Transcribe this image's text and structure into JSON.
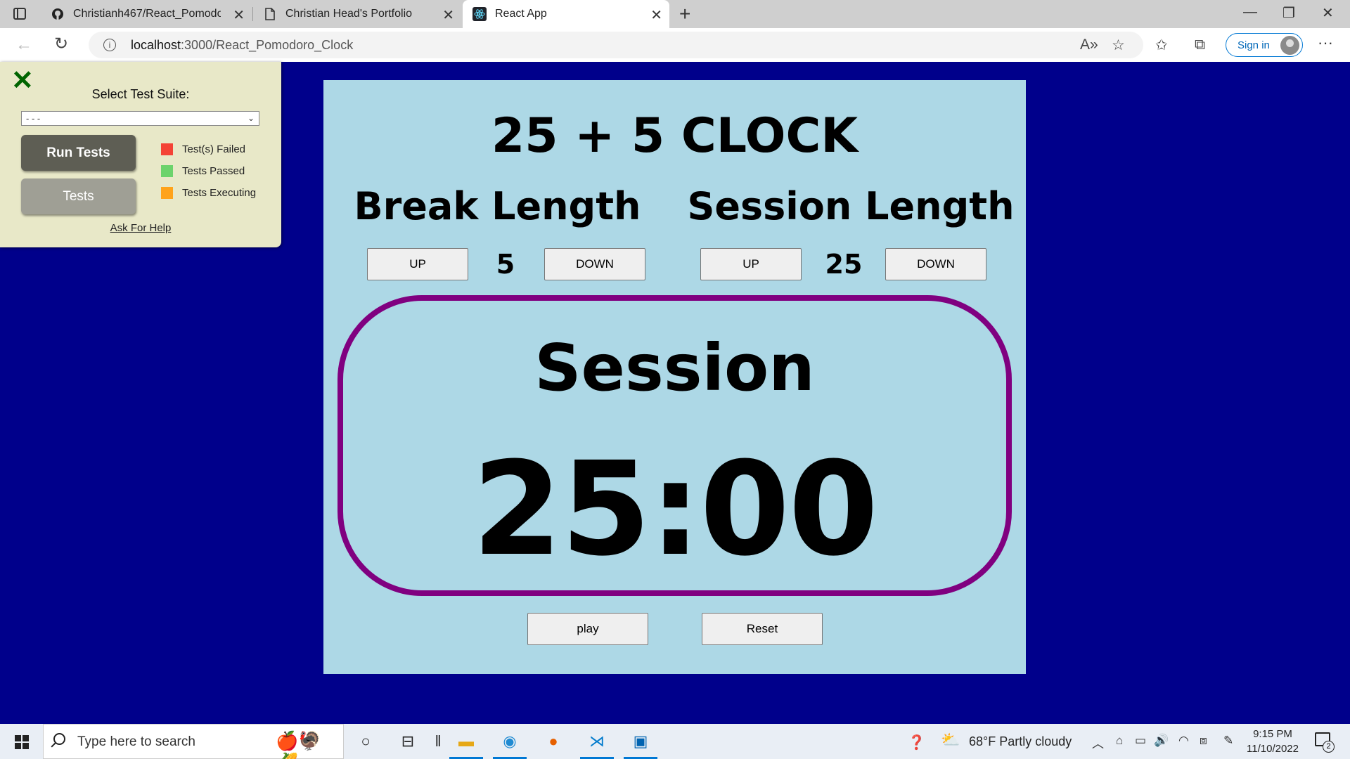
{
  "browser": {
    "tabs": [
      {
        "label": "Christianh467/React_Pomodoro_",
        "icon": "github-icon"
      },
      {
        "label": "Christian Head's Portfolio",
        "icon": "page-icon"
      },
      {
        "label": "React App",
        "icon": "react-icon"
      }
    ],
    "url_host": "localhost",
    "url_path": ":3000/React_Pomodoro_Clock",
    "signin_label": "Sign in"
  },
  "fcc_panel": {
    "title": "Select Test Suite:",
    "select_value": "- - -",
    "run_tests_label": "Run Tests",
    "tests_label": "Tests",
    "legend": [
      {
        "label": "Test(s) Failed",
        "color": "#f44336"
      },
      {
        "label": "Tests Passed",
        "color": "#6cd36c"
      },
      {
        "label": "Tests Executing",
        "color": "#ffa31a"
      }
    ],
    "help_link": "Ask For Help"
  },
  "clock": {
    "title": "25 + 5 CLOCK",
    "break_label": "Break Length",
    "session_label": "Session Length",
    "break_value": "5",
    "session_value": "25",
    "up_label": "UP",
    "down_label": "DOWN",
    "timer_label": "Session",
    "time_left": "25:00",
    "play_label": "play",
    "reset_label": "Reset",
    "colors": {
      "background": "#00008b",
      "panel": "#add8e6",
      "timer_border": "#800080"
    }
  },
  "taskbar": {
    "search_placeholder": "Type here to search",
    "weather": "68°F  Partly cloudy",
    "time": "9:15 PM",
    "date": "11/10/2022",
    "notification_count": "2"
  }
}
